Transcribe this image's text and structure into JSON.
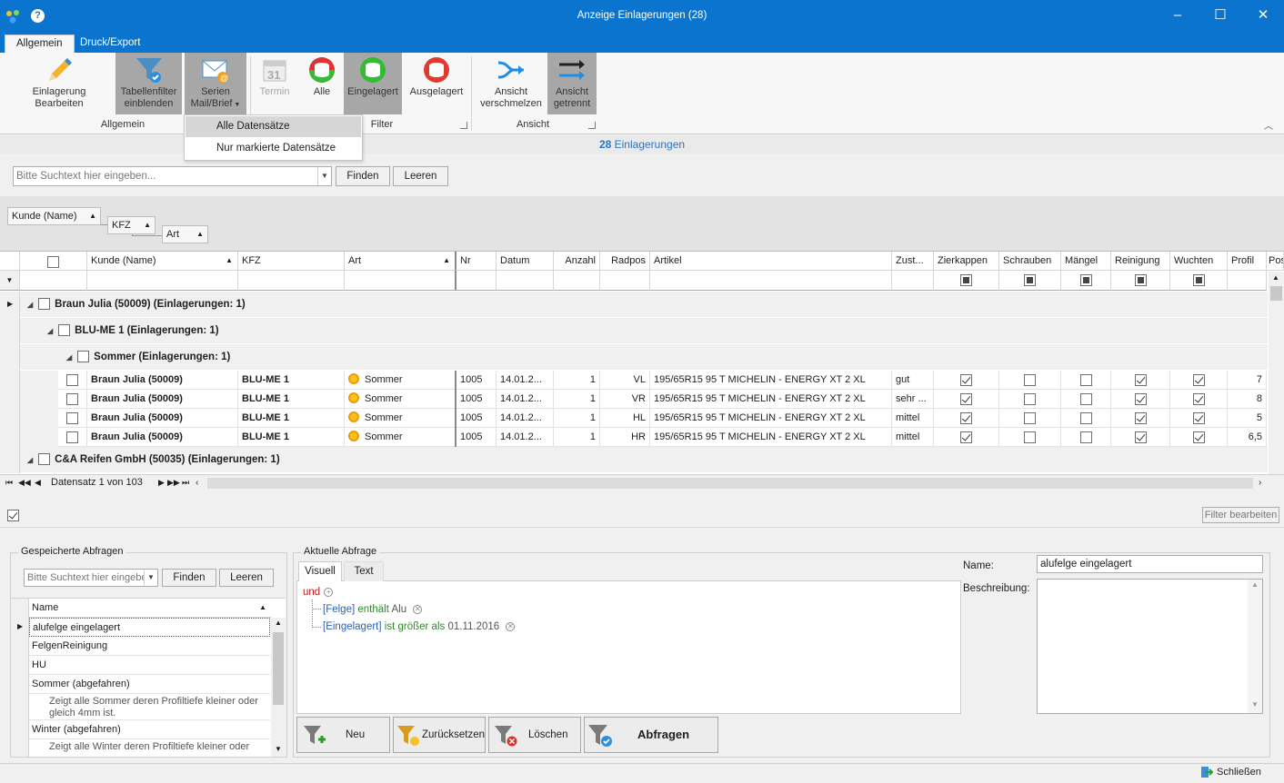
{
  "window": {
    "title": "Anzeige Einlagerungen (28)"
  },
  "ribbon": {
    "tabs": [
      "Allgemein",
      "Druck/Export"
    ],
    "buttons": {
      "edit": "Einlagerung\nBearbeiten",
      "tabfilter": "Tabellenfilter\neinblenden",
      "serien": "Serien\nMail/Brief",
      "termin": "Termin",
      "alle": "Alle",
      "eingelagert": "Eingelagert",
      "ausgelagert": "Ausgelagert",
      "merge": "Ansicht\nverschmelzen",
      "separate": "Ansicht\ngetrennt"
    },
    "groups": {
      "allgemein": "Allgemein",
      "filter": "Filter",
      "ansicht": "Ansicht"
    },
    "termin_day": "31",
    "dropdown": [
      "Alle Datensätze",
      "Nur markierte Datensätze"
    ]
  },
  "records": {
    "count": "28",
    "label": "Einlagerungen"
  },
  "search": {
    "placeholder": "Bitte Suchtext hier eingeben...",
    "find": "Finden",
    "clear": "Leeren"
  },
  "group_chips": [
    "Kunde (Name)",
    "KFZ",
    "Art"
  ],
  "columns": [
    "Kunde (Name)",
    "KFZ",
    "Art",
    "Nr",
    "Datum",
    "Anzahl",
    "Radpos",
    "Artikel",
    "Zust...",
    "Zierkappen",
    "Schrauben",
    "Mängel",
    "Reinigung",
    "Wuchten",
    "Profil",
    "Pos"
  ],
  "groups": {
    "customer1": "Braun Julia (50009) (Einlagerungen: 1)",
    "kfz1": "BLU-ME 1 (Einlagerungen: 1)",
    "art1": "Sommer (Einlagerungen: 1)",
    "customer2": "C&A Reifen GmbH (50035) (Einlagerungen: 1)"
  },
  "rows": [
    {
      "kunde": "Braun Julia (50009)",
      "kfz": "BLU-ME 1",
      "art": "Sommer",
      "nr": "1005",
      "datum": "14.01.2...",
      "anzahl": "1",
      "radpos": "VL",
      "artikel": "195/65R15 95 T MICHELIN - ENERGY XT 2 XL",
      "zustand": "gut",
      "zierkappen": true,
      "schrauben": false,
      "maengel": false,
      "reinigung": true,
      "wuchten": true,
      "profil": "7"
    },
    {
      "kunde": "Braun Julia (50009)",
      "kfz": "BLU-ME 1",
      "art": "Sommer",
      "nr": "1005",
      "datum": "14.01.2...",
      "anzahl": "1",
      "radpos": "VR",
      "artikel": "195/65R15 95 T MICHELIN - ENERGY XT 2 XL",
      "zustand": "sehr ...",
      "zierkappen": true,
      "schrauben": false,
      "maengel": false,
      "reinigung": true,
      "wuchten": true,
      "profil": "8"
    },
    {
      "kunde": "Braun Julia (50009)",
      "kfz": "BLU-ME 1",
      "art": "Sommer",
      "nr": "1005",
      "datum": "14.01.2...",
      "anzahl": "1",
      "radpos": "HL",
      "artikel": "195/65R15 95 T MICHELIN - ENERGY XT 2 XL",
      "zustand": "mittel",
      "zierkappen": true,
      "schrauben": false,
      "maengel": false,
      "reinigung": true,
      "wuchten": true,
      "profil": "5"
    },
    {
      "kunde": "Braun Julia (50009)",
      "kfz": "BLU-ME 1",
      "art": "Sommer",
      "nr": "1005",
      "datum": "14.01.2...",
      "anzahl": "1",
      "radpos": "HR",
      "artikel": "195/65R15 95 T MICHELIN - ENERGY XT 2 XL",
      "zustand": "mittel",
      "zierkappen": true,
      "schrauben": false,
      "maengel": false,
      "reinigung": true,
      "wuchten": true,
      "profil": "6,5"
    }
  ],
  "navigator": {
    "text": "Datensatz 1 von 103"
  },
  "filter_edit": "Filter bearbeiten",
  "saved_queries": {
    "title": "Gespeicherte Abfragen",
    "search_placeholder": "Bitte Suchtext hier eingeben",
    "find": "Finden",
    "clear": "Leeren",
    "col_name": "Name",
    "items": [
      {
        "name": "alufelge eingelagert"
      },
      {
        "name": "FelgenReinigung"
      },
      {
        "name": "HU"
      },
      {
        "name": "Sommer (abgefahren)",
        "desc": "Zeigt alle Sommer deren Profiltiefe kleiner oder gleich 4mm ist."
      },
      {
        "name": "Winter (abgefahren)",
        "desc": "Zeigt alle Winter deren Profiltiefe kleiner oder"
      }
    ]
  },
  "current_query": {
    "title": "Aktuelle Abfrage",
    "tabs": [
      "Visuell",
      "Text"
    ],
    "root": "und",
    "cond1": {
      "field": "[Felge]",
      "op": "enthält",
      "value": "Alu"
    },
    "cond2": {
      "field": "[Eingelagert]",
      "op": "ist größer als",
      "value": "01.11.2016"
    },
    "name_label": "Name:",
    "name_value": "alufelge eingelagert",
    "desc_label": "Beschreibung:",
    "buttons": {
      "new": "Neu",
      "reset": "Zurücksetzen",
      "delete": "Löschen",
      "query": "Abfragen"
    }
  },
  "statusbar": {
    "close": "Schließen"
  },
  "colors": {
    "accent": "#0a74cf",
    "pressed": "#a7a7a7",
    "link": "#2377c8"
  }
}
